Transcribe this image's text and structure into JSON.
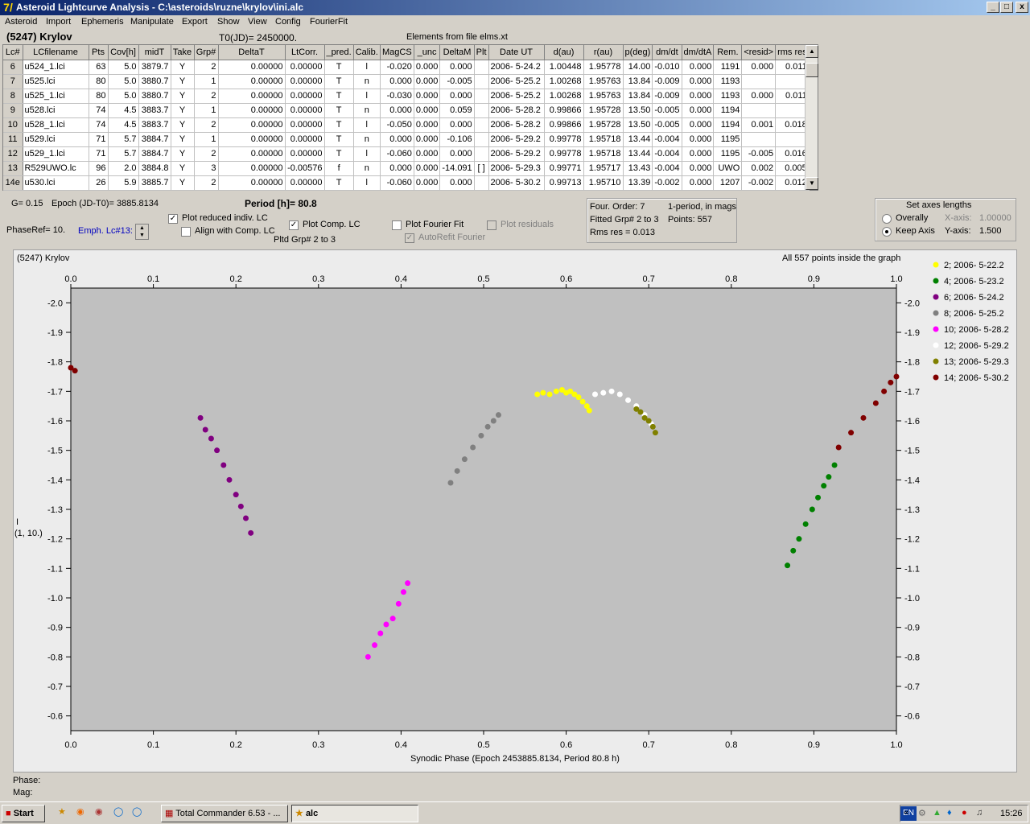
{
  "window": {
    "title": "Asteroid Lightcurve Analysis - C:\\asteroids\\ruzne\\krylov\\ini.alc",
    "icon": "7/"
  },
  "menu": [
    "Asteroid",
    "Import",
    "Ephemeris",
    "Manipulate",
    "Export",
    "Show",
    "View",
    "Config",
    "FourierFit"
  ],
  "header": {
    "asteroid": "(5247) Krylov",
    "t0": "T0(JD)= 2450000.",
    "elements": "Elements from file elms.xt"
  },
  "table": {
    "columns": [
      "Lc#",
      "LCfilename",
      "Pts",
      "Cov[h]",
      "midT",
      "Take",
      "Grp#",
      "DeltaT",
      "LtCorr.",
      "_pred.",
      "Calib.",
      "MagCS",
      "_unc",
      "DeltaM",
      "Plt",
      "Date UT",
      "d(au)",
      "r(au)",
      "p(deg)",
      "dm/dt",
      "dm/dtA",
      "Rem.",
      "<resid>",
      "rms res"
    ],
    "rows": [
      [
        "6",
        "u524_1.lci",
        "63",
        "5.0",
        "3879.7",
        "Y",
        "2",
        "0.00000",
        "0.00000",
        "T",
        "l",
        "-0.020",
        "0.000",
        "0.000",
        "",
        "2006- 5-24.2",
        "1.00448",
        "1.95778",
        "14.00",
        "-0.010",
        "0.000",
        "1191",
        "0.000",
        "0.011"
      ],
      [
        "7",
        "u525.lci",
        "80",
        "5.0",
        "3880.7",
        "Y",
        "1",
        "0.00000",
        "0.00000",
        "T",
        "n",
        "0.000",
        "0.000",
        "-0.005",
        "",
        "2006- 5-25.2",
        "1.00268",
        "1.95763",
        "13.84",
        "-0.009",
        "0.000",
        "1193",
        "",
        ""
      ],
      [
        "8",
        "u525_1.lci",
        "80",
        "5.0",
        "3880.7",
        "Y",
        "2",
        "0.00000",
        "0.00000",
        "T",
        "l",
        "-0.030",
        "0.000",
        "0.000",
        "",
        "2006- 5-25.2",
        "1.00268",
        "1.95763",
        "13.84",
        "-0.009",
        "0.000",
        "1193",
        "0.000",
        "0.011"
      ],
      [
        "9",
        "u528.lci",
        "74",
        "4.5",
        "3883.7",
        "Y",
        "1",
        "0.00000",
        "0.00000",
        "T",
        "n",
        "0.000",
        "0.000",
        "0.059",
        "",
        "2006- 5-28.2",
        "0.99866",
        "1.95728",
        "13.50",
        "-0.005",
        "0.000",
        "1194",
        "",
        ""
      ],
      [
        "10",
        "u528_1.lci",
        "74",
        "4.5",
        "3883.7",
        "Y",
        "2",
        "0.00000",
        "0.00000",
        "T",
        "l",
        "-0.050",
        "0.000",
        "0.000",
        "",
        "2006- 5-28.2",
        "0.99866",
        "1.95728",
        "13.50",
        "-0.005",
        "0.000",
        "1194",
        "0.001",
        "0.018"
      ],
      [
        "11",
        "u529.lci",
        "71",
        "5.7",
        "3884.7",
        "Y",
        "1",
        "0.00000",
        "0.00000",
        "T",
        "n",
        "0.000",
        "0.000",
        "-0.106",
        "",
        "2006- 5-29.2",
        "0.99778",
        "1.95718",
        "13.44",
        "-0.004",
        "0.000",
        "1195",
        "",
        ""
      ],
      [
        "12",
        "u529_1.lci",
        "71",
        "5.7",
        "3884.7",
        "Y",
        "2",
        "0.00000",
        "0.00000",
        "T",
        "l",
        "-0.060",
        "0.000",
        "0.000",
        "",
        "2006- 5-29.2",
        "0.99778",
        "1.95718",
        "13.44",
        "-0.004",
        "0.000",
        "1195",
        "-0.005",
        "0.016"
      ],
      [
        "13",
        "R529UWO.lc",
        "96",
        "2.0",
        "3884.8",
        "Y",
        "3",
        "0.00000",
        "-0.00576",
        "f",
        "n",
        "0.000",
        "0.000",
        "-14.091",
        "[ ]",
        "2006- 5-29.3",
        "0.99771",
        "1.95717",
        "13.43",
        "-0.004",
        "0.000",
        "UWO",
        "0.002",
        "0.005"
      ],
      [
        "14e",
        "u530.lci",
        "26",
        "5.9",
        "3885.7",
        "Y",
        "2",
        "0.00000",
        "0.00000",
        "T",
        "l",
        "-0.060",
        "0.000",
        "0.000",
        "",
        "2006- 5-30.2",
        "0.99713",
        "1.95710",
        "13.39",
        "-0.002",
        "0.000",
        "1207",
        "-0.002",
        "0.012"
      ]
    ]
  },
  "controls": {
    "g": "G= 0.15",
    "epoch": "Epoch (JD-T0)= 3885.8134",
    "period": "Period [h]= 80.8",
    "phaseref": "PhaseRef= 10.",
    "emph": "Emph. Lc#13:",
    "plot_reduced": "Plot reduced indiv. LC",
    "align_comp": "Align with Comp. LC",
    "plot_comp": "Plot Comp. LC",
    "pltd_grp": "Pltd Grp#  2  to   3",
    "plot_fourier": "Plot Fourier Fit",
    "autorefit": "AutoRefit Fourier",
    "plot_resid": "Plot residuals"
  },
  "fourier": {
    "order": "Four. Order:  7",
    "period_mode": "1-period, in mags",
    "fitted": "Fitted Grp# 2 to 3",
    "points": "Points: 557",
    "rms": "Rms res      = 0.013"
  },
  "axes": {
    "title": "Set axes lengths",
    "overall": "Overally",
    "keep": "Keep Axis",
    "xaxis_label": "X-axis:",
    "xaxis_val": "1.00000",
    "yaxis_label": "Y-axis:",
    "yaxis_val": "1.500"
  },
  "plot": {
    "title": "(5247) Krylov",
    "info": "All 557 points inside the graph",
    "ylabel_1": "I",
    "ylabel_2": "(1, 10.)",
    "xlabel": "Synodic Phase (Epoch 2453885.8134, Period 80.8 h)",
    "phase_label": "Phase:",
    "mag_label": "Mag:"
  },
  "chart_data": {
    "type": "scatter",
    "xlim": [
      0.0,
      1.0
    ],
    "ylim": [
      -0.55,
      -2.05
    ],
    "y_inverted": true,
    "x_ticks": [
      "0.0",
      "0.1",
      "0.2",
      "0.3",
      "0.4",
      "0.5",
      "0.6",
      "0.7",
      "0.8",
      "0.9",
      "1.0"
    ],
    "y_ticks": [
      "-2.0",
      "-1.9",
      "-1.8",
      "-1.7",
      "-1.6",
      "-1.5",
      "-1.4",
      "-1.3",
      "-1.2",
      "-1.1",
      "-1.0",
      "-0.9",
      "-0.8",
      "-0.7",
      "-0.6"
    ],
    "series": [
      {
        "name": "2; 2006- 5-22.2",
        "color": "#ffff00",
        "x": [
          0.565,
          0.572,
          0.58,
          0.588,
          0.595,
          0.6,
          0.605,
          0.61,
          0.615,
          0.62,
          0.625,
          0.628
        ],
        "y": [
          -1.69,
          -1.695,
          -1.69,
          -1.7,
          -1.705,
          -1.695,
          -1.7,
          -1.69,
          -1.68,
          -1.665,
          -1.65,
          -1.635
        ]
      },
      {
        "name": "4; 2006- 5-23.2",
        "color": "#008000",
        "x": [
          0.868,
          0.875,
          0.882,
          0.89,
          0.898,
          0.905,
          0.912,
          0.918,
          0.925
        ],
        "y": [
          -1.11,
          -1.16,
          -1.2,
          -1.25,
          -1.3,
          -1.34,
          -1.38,
          -1.41,
          -1.45
        ]
      },
      {
        "name": "6; 2006- 5-24.2",
        "color": "#800080",
        "x": [
          0.157,
          0.163,
          0.17,
          0.177,
          0.185,
          0.192,
          0.2,
          0.206,
          0.212,
          0.218
        ],
        "y": [
          -1.61,
          -1.57,
          -1.54,
          -1.5,
          -1.45,
          -1.4,
          -1.35,
          -1.31,
          -1.27,
          -1.22
        ]
      },
      {
        "name": "8; 2006- 5-25.2",
        "color": "#808080",
        "x": [
          0.46,
          0.468,
          0.477,
          0.487,
          0.497,
          0.505,
          0.512,
          0.518
        ],
        "y": [
          -1.39,
          -1.43,
          -1.47,
          -1.51,
          -1.55,
          -1.58,
          -1.6,
          -1.62
        ]
      },
      {
        "name": "10; 2006- 5-28.2",
        "color": "#ff00ff",
        "x": [
          0.36,
          0.368,
          0.375,
          0.382,
          0.39,
          0.397,
          0.403,
          0.408
        ],
        "y": [
          -0.8,
          -0.84,
          -0.88,
          -0.91,
          -0.93,
          -0.98,
          -1.02,
          -1.05
        ]
      },
      {
        "name": "12; 2006- 5-29.2",
        "color": "#ffffff",
        "x": [
          0.635,
          0.645,
          0.655,
          0.665,
          0.675,
          0.685,
          0.695,
          0.703
        ],
        "y": [
          -1.69,
          -1.695,
          -1.7,
          -1.69,
          -1.67,
          -1.65,
          -1.62,
          -1.59
        ]
      },
      {
        "name": "13; 2006- 5-29.3",
        "color": "#808000",
        "x": [
          0.685,
          0.69,
          0.695,
          0.7,
          0.705,
          0.708
        ],
        "y": [
          -1.64,
          -1.63,
          -1.61,
          -1.6,
          -1.58,
          -1.56
        ]
      },
      {
        "name": "14; 2006- 5-30.2",
        "color": "#800000",
        "x": [
          0.0,
          0.005,
          0.93,
          0.945,
          0.96,
          0.975,
          0.985,
          0.993,
          1.0
        ],
        "y": [
          -1.78,
          -1.77,
          -1.51,
          -1.56,
          -1.61,
          -1.66,
          -1.7,
          -1.73,
          -1.75
        ]
      }
    ]
  },
  "taskbar": {
    "start": "Start",
    "task1": "Total Commander 6.53 - ...",
    "task2": "alc",
    "lang": "EN",
    "clock": "15:26"
  }
}
